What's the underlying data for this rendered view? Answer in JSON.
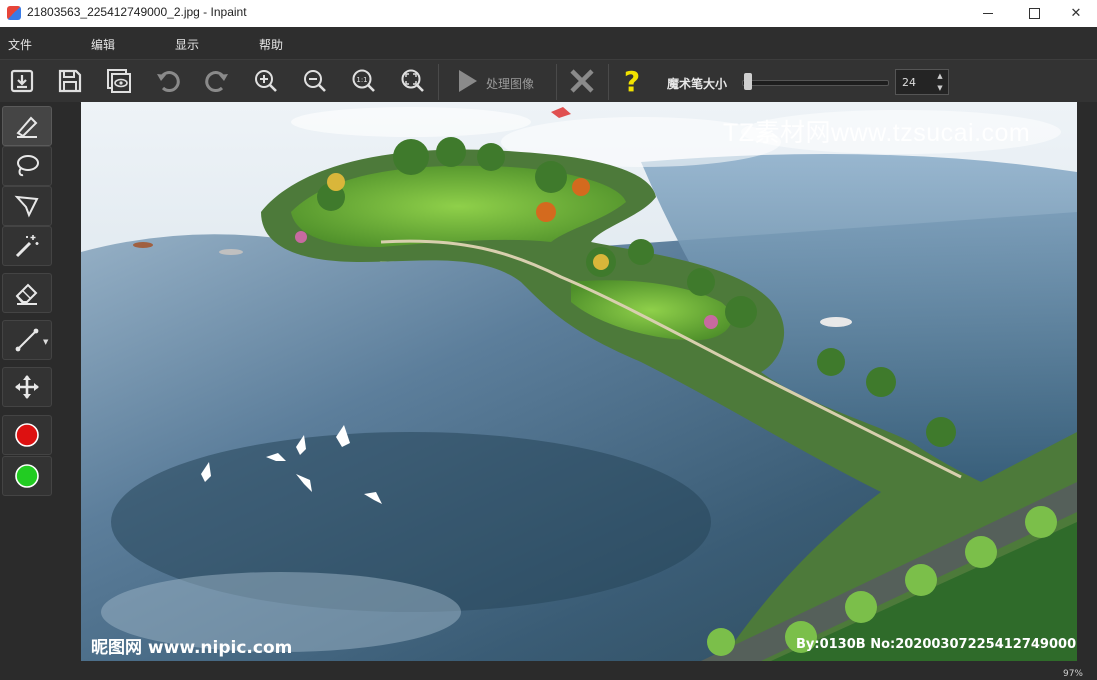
{
  "window": {
    "title": "21803563_225412749000_2.jpg - Inpaint",
    "minimize": "—",
    "close": "✕"
  },
  "menu": [
    {
      "label": "文件"
    },
    {
      "label": "编辑"
    },
    {
      "label": "显示"
    },
    {
      "label": "帮助"
    }
  ],
  "toolbar": {
    "icons": [
      "open-icon",
      "save-icon",
      "preview-icon",
      "undo-icon",
      "redo-icon",
      "zoom-in-icon",
      "zoom-out-icon",
      "actual-size-icon",
      "fit-window-icon",
      "run-icon",
      "cancel-icon",
      "help-icon"
    ],
    "process_label": "处理图像",
    "help_glyph": "?",
    "brush_size_label": "魔术笔大小",
    "brush_size_value": "24",
    "brush_size_fraction": 0.02
  },
  "tools": [
    {
      "name": "marker-tool",
      "icon": "marker-icon",
      "active": true
    },
    {
      "name": "lasso-tool",
      "icon": "lasso-icon"
    },
    {
      "name": "polygon-lasso-tool",
      "icon": "polygon-lasso-icon"
    },
    {
      "name": "magic-wand-tool",
      "icon": "magic-wand-icon"
    },
    {
      "name": "eraser-tool",
      "icon": "eraser-icon"
    },
    {
      "name": "line-tool",
      "icon": "line-icon"
    },
    {
      "name": "move-tool",
      "icon": "move-icon"
    },
    {
      "name": "red-mark-color",
      "icon": "red-circle-icon",
      "color": "#dd1111"
    },
    {
      "name": "green-keep-color",
      "icon": "green-circle-icon",
      "color": "#22cc22"
    }
  ],
  "canvas": {
    "watermark_top": "TZ素材网www.tzsucai.com",
    "watermark_bottom_left": "昵图网 www.nipic.com",
    "watermark_bottom_right": "By:0130B No:20200307225412749000"
  },
  "status": {
    "zoom": "97%"
  },
  "colors": {
    "background": "#2b2b2b",
    "toolbar": "#333333",
    "titlebar": "#ffffff"
  }
}
